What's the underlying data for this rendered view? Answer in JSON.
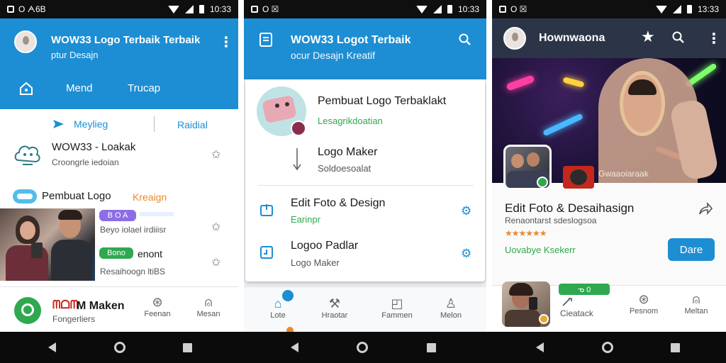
{
  "phone1": {
    "status": {
      "left": "O ᗅ6B",
      "time": "10:33"
    },
    "appbar": {
      "title": "WOW33 Logo Terbaik Terbaik",
      "subtitle": "ptur Desajn"
    },
    "tabs": {
      "tab1": "Mend",
      "tab2": "Trucap"
    },
    "filter": {
      "left": "Meylieg",
      "right": "Raidial"
    },
    "items": [
      {
        "title": "WOW33 - Loakak",
        "sub": "Croongrle iedoian"
      },
      {
        "title": "Pembuat Logo",
        "title_accent": "Kreaign",
        "chip1": "B O A",
        "sub1": "Beyo iolael irdiiisr",
        "chip2": "Bono",
        "sub2_head": "enont",
        "sub2": "Resaihoogn ltiBS"
      }
    ],
    "bottom_nav": {
      "brand_title": "M Maken",
      "brand_red": "ᗰᗝᗰ",
      "brand_sub": "Fongerliers",
      "item2": "Feenan",
      "item3": "Mesan"
    }
  },
  "phone2": {
    "status": {
      "left": "O ☒",
      "time": "10:33"
    },
    "appbar": {
      "title": "WOW33 Logot Terbaik",
      "subtitle": "ocur Desajn Kreatif"
    },
    "items": [
      {
        "title": "Pembuat Logo Terbaklakt",
        "sub": "Lesagrikdoatian"
      },
      {
        "title": "Logo Maker",
        "sub": "Soldoesoalat"
      },
      {
        "title": "Edit Foto & Design",
        "sub": "Earinpr"
      },
      {
        "title": "Logoo Padlar",
        "sub": "Logo Maker"
      }
    ],
    "bottom_nav": {
      "item1": "Lote",
      "item2": "Hraotar",
      "item3": "Fammen",
      "item4": "Melon"
    }
  },
  "phone3": {
    "status": {
      "left": "O ☒",
      "time": "13:33"
    },
    "appbar": {
      "title": "Hownwaona"
    },
    "hero": {
      "caption": "Gwaaoiaraak"
    },
    "app": {
      "title": "Edit Foto & Desaihasign",
      "sub": "Renaontarst sdeslogsoa",
      "rating": "★★★★★★",
      "dev": "Uovabye Ksekerr",
      "button": "Dare"
    },
    "bottom_nav": {
      "chip": "ᓀ 0",
      "item1": "Cieatack",
      "item2": "Pesnom",
      "item3": "Meltan"
    }
  },
  "colors": {
    "primary": "#1d8ed3",
    "accent_green": "#2fa84f",
    "accent_orange": "#e88a2b",
    "brand_red": "#c4281c"
  }
}
